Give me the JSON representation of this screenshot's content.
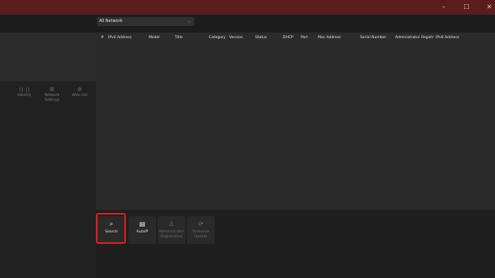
{
  "window": {
    "minimize_glyph": "–",
    "maximize_glyph": "☐",
    "close_glyph": "✕",
    "titlebar_color": "#5a1d1d"
  },
  "sidebar": {
    "tools": [
      {
        "icon": "antenna-icon",
        "glyph": "((·))",
        "label": "Identify"
      },
      {
        "icon": "network-settings-icon",
        "glyph": "⊞",
        "label": "Network Settings"
      },
      {
        "icon": "globe-icon",
        "glyph": "⊕",
        "label": "Web GUI"
      }
    ]
  },
  "network_filter": {
    "selected": "All Network",
    "chevron": "⌵"
  },
  "table": {
    "columns": [
      "#",
      "IPv4 Address",
      "Model",
      "Title",
      "Category",
      "Version",
      "Status",
      "DHCP",
      "Port",
      "Mac Address",
      "Serial Number",
      "Administrator Registr",
      "IPv6 Address"
    ],
    "rows": []
  },
  "actions": [
    {
      "icon": "search-icon",
      "glyph": "⌕",
      "label": "Search",
      "enabled": true,
      "highlighted": true
    },
    {
      "icon": "autoip-icon",
      "glyph": "▤",
      "label": "AutoIP",
      "enabled": true
    },
    {
      "icon": "administrator-icon",
      "glyph": "♙",
      "label": "Administrator Registration",
      "enabled": false
    },
    {
      "icon": "firmware-update-icon",
      "glyph": "⟳",
      "label": "Firmware Update",
      "enabled": false
    }
  ],
  "colors": {
    "highlight": "#e01e1e",
    "background": "#212121",
    "table_background": "#2b2b2b"
  }
}
